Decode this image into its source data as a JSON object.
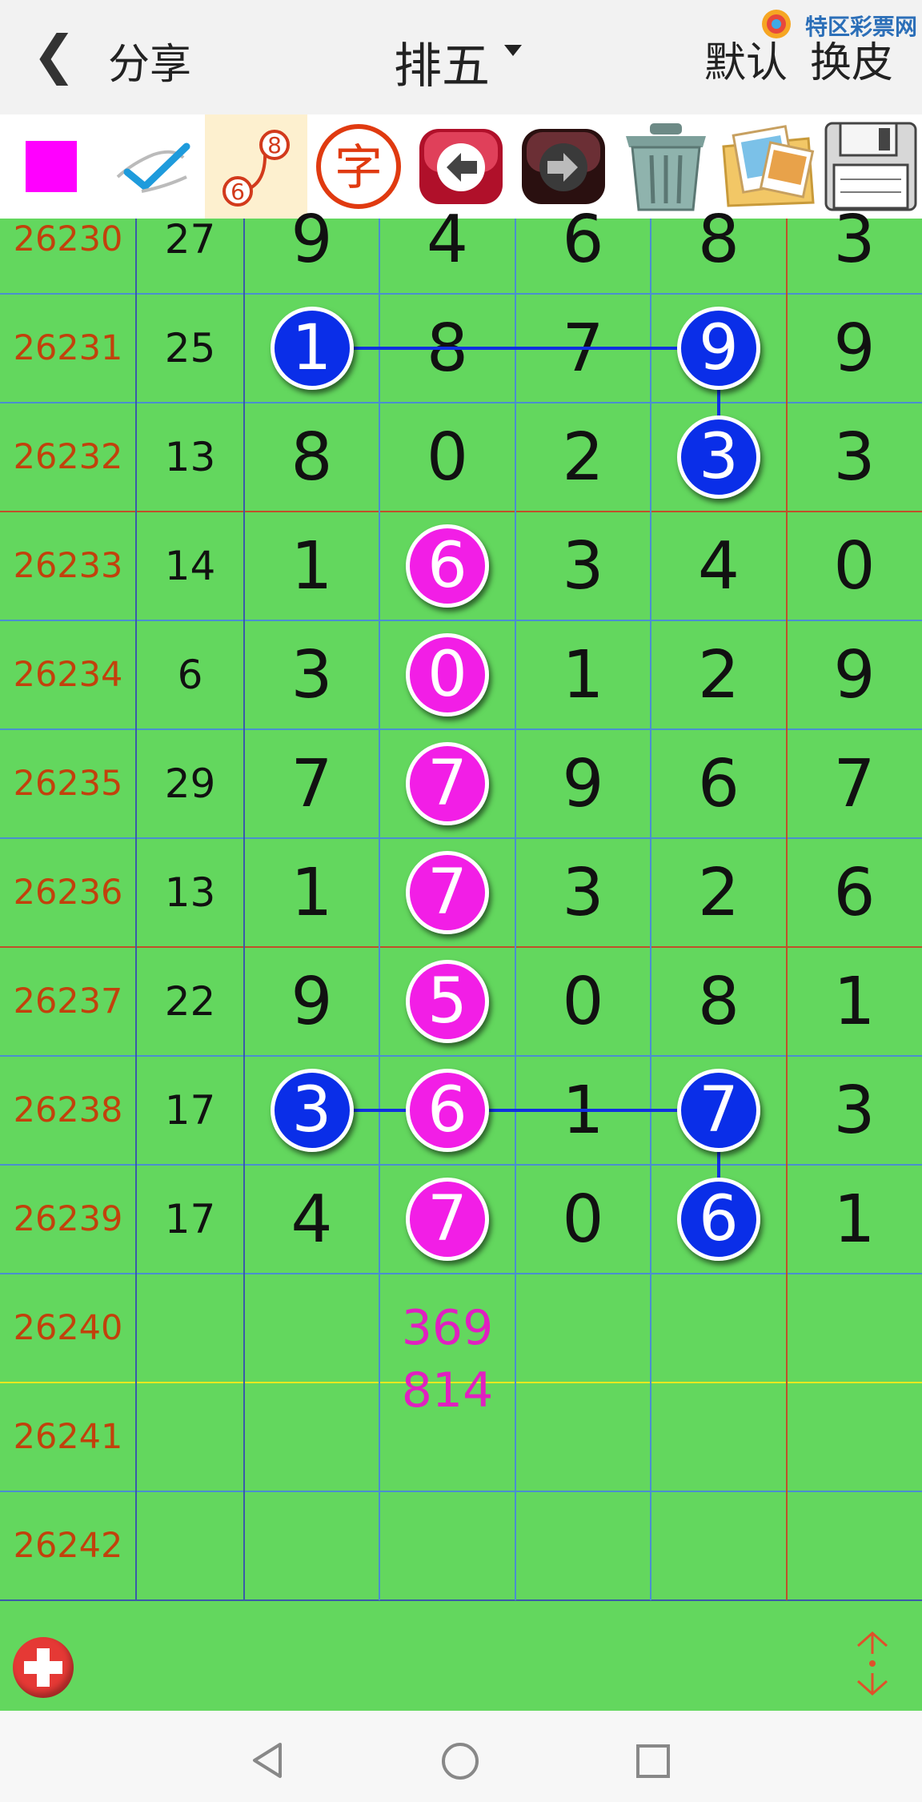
{
  "header": {
    "back_icon": "chevron-left-icon",
    "share_label": "分享",
    "title": "排五",
    "default_label": "默认",
    "skin_label": "换皮",
    "watermark_text": "特区彩票网"
  },
  "toolbar": {
    "tools": [
      "color-swatch",
      "pen-check",
      "link-balls",
      "text-char",
      "undo-arrow",
      "redo-arrow",
      "trash",
      "photos",
      "save-disk"
    ],
    "color_swatch": "#ff00ff",
    "text_tool_char": "字",
    "link_tool_top": "8",
    "link_tool_bottom": "6"
  },
  "rows": [
    {
      "issue": "26230",
      "sum": "27",
      "d": [
        "9",
        "4",
        "6",
        "8",
        "3"
      ]
    },
    {
      "issue": "26231",
      "sum": "25",
      "d": [
        "1",
        "8",
        "7",
        "9",
        "9"
      ]
    },
    {
      "issue": "26232",
      "sum": "13",
      "d": [
        "8",
        "0",
        "2",
        "3",
        "3"
      ]
    },
    {
      "issue": "26233",
      "sum": "14",
      "d": [
        "1",
        "6",
        "3",
        "4",
        "0"
      ]
    },
    {
      "issue": "26234",
      "sum": "6",
      "d": [
        "3",
        "0",
        "1",
        "2",
        "9"
      ]
    },
    {
      "issue": "26235",
      "sum": "29",
      "d": [
        "7",
        "7",
        "9",
        "6",
        "7"
      ]
    },
    {
      "issue": "26236",
      "sum": "13",
      "d": [
        "1",
        "7",
        "3",
        "2",
        "6"
      ]
    },
    {
      "issue": "26237",
      "sum": "22",
      "d": [
        "9",
        "5",
        "0",
        "8",
        "1"
      ]
    },
    {
      "issue": "26238",
      "sum": "17",
      "d": [
        "3",
        "6",
        "1",
        "7",
        "3"
      ]
    },
    {
      "issue": "26239",
      "sum": "17",
      "d": [
        "4",
        "7",
        "0",
        "6",
        "1"
      ]
    },
    {
      "issue": "26240",
      "sum": "",
      "d": [
        "",
        "",
        "",
        "",
        ""
      ]
    },
    {
      "issue": "26241",
      "sum": "",
      "d": [
        "",
        "",
        "",
        "",
        ""
      ]
    },
    {
      "issue": "26242",
      "sum": "",
      "d": [
        "",
        "",
        "",
        "",
        ""
      ]
    }
  ],
  "blue_balls": [
    [
      1,
      0
    ],
    [
      1,
      3
    ],
    [
      2,
      3
    ],
    [
      8,
      0
    ],
    [
      8,
      3
    ],
    [
      9,
      3
    ]
  ],
  "magenta_balls": [
    [
      3,
      1
    ],
    [
      4,
      1
    ],
    [
      5,
      1
    ],
    [
      6,
      1
    ],
    [
      7,
      1
    ],
    [
      8,
      1
    ],
    [
      9,
      1
    ]
  ],
  "colors": {
    "grid_bg": "#63d75e",
    "blue_ball": "#0a2ee8",
    "magenta_ball": "#f21ee6",
    "issue_text": "#c2410c",
    "prediction": "#e020c0"
  },
  "prediction": {
    "line1": "369",
    "line2": "814"
  },
  "bottom": {
    "add_icon": "plus-circle-icon",
    "scroll_icon": "scroll-updown-icon"
  },
  "navbar": {
    "back": "nav-back-icon",
    "home": "nav-home-icon",
    "recent": "nav-recent-icon"
  }
}
